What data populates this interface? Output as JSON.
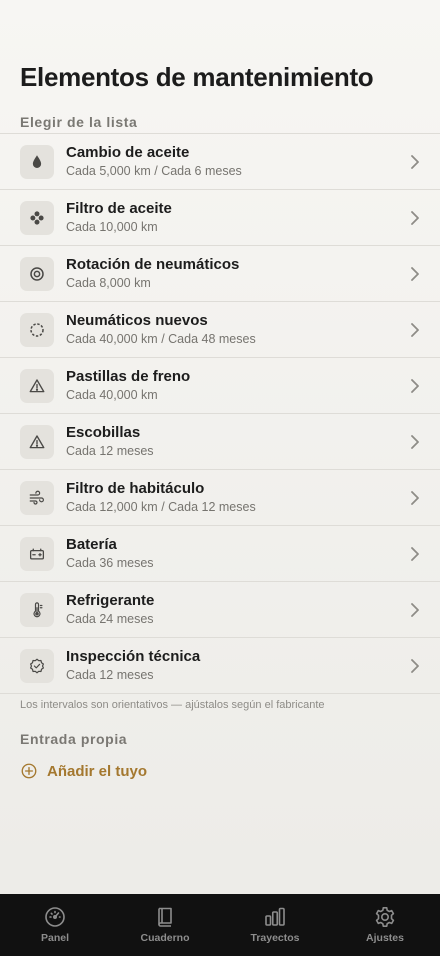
{
  "header": {
    "title": "Elementos de mantenimiento"
  },
  "sections": {
    "list_label": "Elegir de la lista",
    "custom_label": "Entrada propia"
  },
  "items": [
    {
      "title": "Cambio de aceite",
      "subtitle": "Cada 5,000 km / Cada 6 meses",
      "icon": "drop-icon"
    },
    {
      "title": "Filtro de aceite",
      "subtitle": "Cada 10,000 km",
      "icon": "filter-dots-icon"
    },
    {
      "title": "Rotación de neumáticos",
      "subtitle": "Cada 8,000 km",
      "icon": "tire-rotation-icon"
    },
    {
      "title": "Neumáticos nuevos",
      "subtitle": "Cada 40,000 km / Cada 48 meses",
      "icon": "tire-icon"
    },
    {
      "title": "Pastillas de freno",
      "subtitle": "Cada 40,000 km",
      "icon": "warning-icon"
    },
    {
      "title": "Escobillas",
      "subtitle": "Cada 12 meses",
      "icon": "warning-icon"
    },
    {
      "title": "Filtro de habitáculo",
      "subtitle": "Cada 12,000 km / Cada 12 meses",
      "icon": "wind-icon"
    },
    {
      "title": "Batería",
      "subtitle": "Cada 36 meses",
      "icon": "battery-icon"
    },
    {
      "title": "Refrigerante",
      "subtitle": "Cada 24 meses",
      "icon": "thermometer-icon"
    },
    {
      "title": "Inspección técnica",
      "subtitle": "Cada 12 meses",
      "icon": "check-badge-icon"
    }
  ],
  "note": "Los intervalos son orientativos — ajústalos según el fabricante",
  "add": {
    "label": "Añadir el tuyo"
  },
  "tabs": [
    {
      "label": "Panel",
      "icon": "gauge-icon"
    },
    {
      "label": "Cuaderno",
      "icon": "book-icon"
    },
    {
      "label": "Trayectos",
      "icon": "bars-icon"
    },
    {
      "label": "Ajustes",
      "icon": "gear-icon"
    }
  ],
  "colors": {
    "accent": "#a4782f",
    "tabbar": "#111111",
    "icon": "#4a4946"
  }
}
